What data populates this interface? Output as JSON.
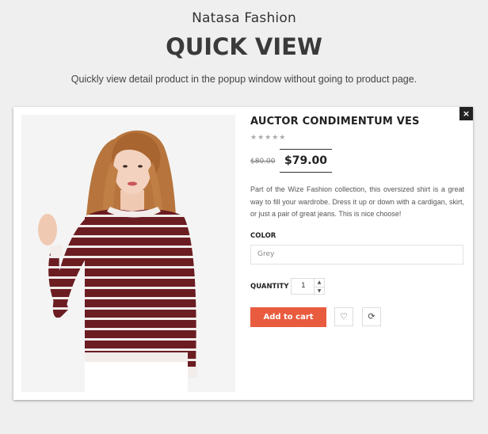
{
  "header": {
    "brand": "Natasa Fashion",
    "heading": "QUICK VIEW",
    "subtitle": "Quickly view detail product in the popup window without going to product page."
  },
  "popup": {
    "close_label": "×",
    "product": {
      "title": "AUCTOR CONDIMENTUM VES",
      "stars": "★★★★★",
      "rating": 0,
      "old_price": "$80.00",
      "new_price": "$79.00",
      "description": "Part of the Wize Fashion collection, this oversized shirt is a great way to fill your wardrobe. Dress it up or down with a cardigan, skirt, or just a pair of great jeans. This is nice choose!",
      "color_label": "COLOR",
      "color_value": "Grey",
      "quantity_label": "QUANTITY",
      "quantity_value": "1",
      "qty_up_icon": "▲",
      "qty_down_icon": "▼",
      "add_to_cart_label": "Add to cart",
      "wishlist_icon": "♡",
      "compare_icon": "⟳"
    }
  },
  "colors": {
    "accent": "#e95b3e",
    "background": "#efefef",
    "sweater": "#6b1d22"
  }
}
